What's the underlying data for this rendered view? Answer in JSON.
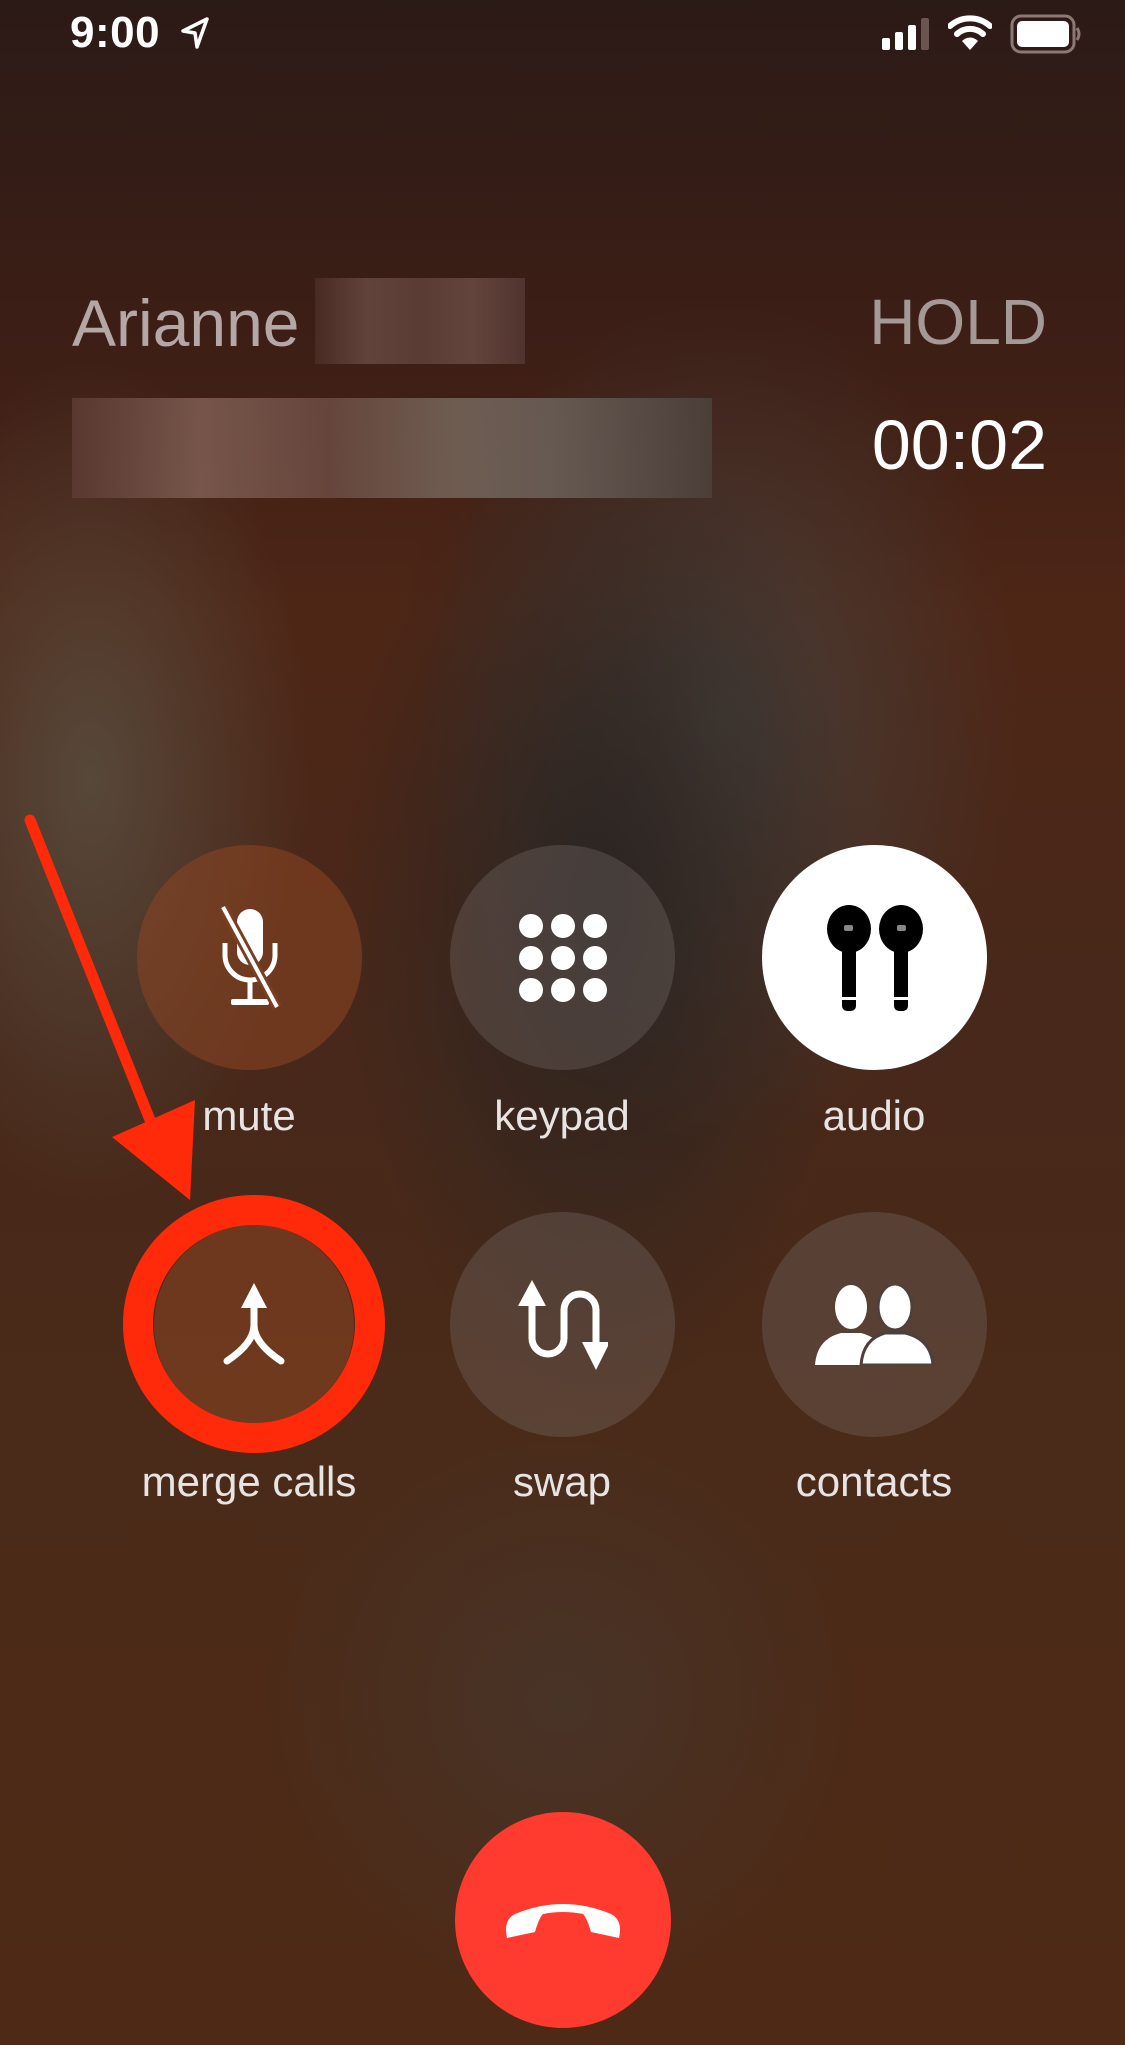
{
  "status_bar": {
    "time": "9:00",
    "location_icon": "location-arrow-icon",
    "signal_icon": "cellular-signal-icon",
    "wifi_icon": "wifi-icon",
    "battery_icon": "battery-full-icon"
  },
  "call": {
    "caller_name": "Arianne",
    "caller_name_redacted": true,
    "number_redacted": true,
    "state": "HOLD",
    "timer": "00:02"
  },
  "controls": [
    {
      "id": "mute",
      "label": "mute",
      "icon": "microphone-slash-icon"
    },
    {
      "id": "keypad",
      "label": "keypad",
      "icon": "keypad-icon"
    },
    {
      "id": "audio",
      "label": "audio",
      "icon": "airpods-icon",
      "active": true
    },
    {
      "id": "merge",
      "label": "merge calls",
      "icon": "merge-arrow-icon",
      "highlighted": true
    },
    {
      "id": "swap",
      "label": "swap",
      "icon": "swap-arrows-icon"
    },
    {
      "id": "contacts",
      "label": "contacts",
      "icon": "contacts-icon"
    }
  ],
  "end_call": {
    "icon": "phone-hangup-icon"
  },
  "annotation": {
    "type": "red arrow and ring",
    "target": "merge calls",
    "color": "#ff2a0a"
  },
  "colors": {
    "end_call": "#ff3b30",
    "annotation_red": "#ff2a0a"
  }
}
